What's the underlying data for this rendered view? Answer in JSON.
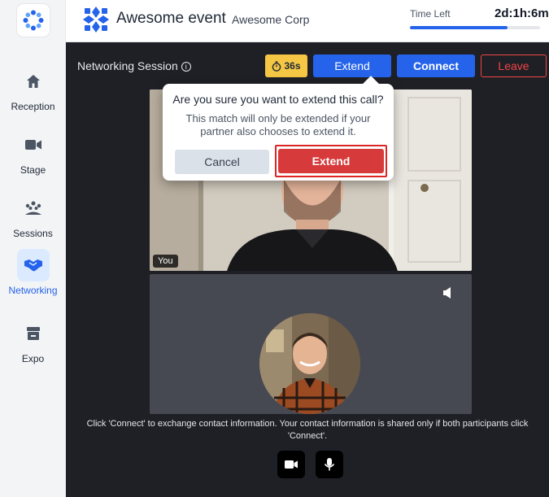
{
  "header": {
    "event_title": "Awesome event",
    "corp_name": "Awesome Corp",
    "time_left_label": "Time Left",
    "time_left_value": "2d:1h:6m",
    "time_progress": 0.75,
    "brand_color": "#2563eb"
  },
  "sidebar": {
    "logo_icon": "event-logo-icon",
    "items": [
      {
        "label": "Reception",
        "icon": "home-icon",
        "active": false
      },
      {
        "label": "Stage",
        "icon": "video-camera-icon",
        "active": false
      },
      {
        "label": "Sessions",
        "icon": "people-group-icon",
        "active": false
      },
      {
        "label": "Networking",
        "icon": "handshake-icon",
        "active": true
      },
      {
        "label": "Expo",
        "icon": "store-icon",
        "active": false
      }
    ]
  },
  "session": {
    "title": "Networking Session",
    "timer": "36s",
    "extend_label": "Extend",
    "connect_label": "Connect",
    "leave_label": "Leave"
  },
  "videos": {
    "self_tag": "You"
  },
  "popover": {
    "title": "Are you sure you want to extend this call?",
    "description": "This match will only be extended if your partner also chooses to extend it.",
    "cancel_label": "Cancel",
    "extend_label": "Extend"
  },
  "footer": {
    "info_text": "Click 'Connect' to exchange contact information. Your contact information is shared only if both participants click 'Connect'."
  },
  "colors": {
    "accent": "#2563eb",
    "danger": "#dc2626",
    "timer_bg": "#f6c744",
    "main_bg": "#1f2026"
  }
}
